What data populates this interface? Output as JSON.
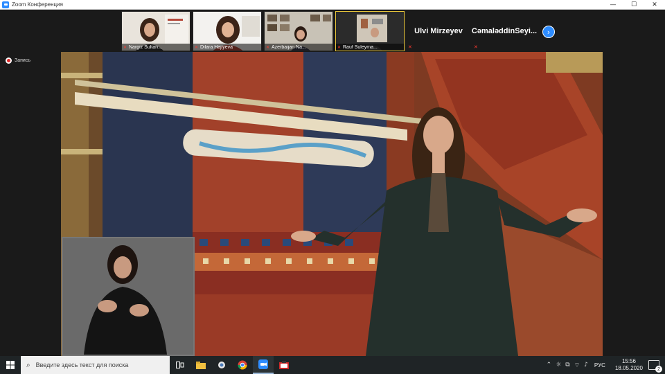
{
  "window": {
    "title": "Zoom Конференция",
    "controls": {
      "minimize": "—",
      "maximize": "☐",
      "close": "✕"
    }
  },
  "gallery": {
    "tiles": [
      {
        "name": "Nargiz Sultan...",
        "muted": true
      },
      {
        "name": "Dilara Hajiyeva",
        "muted": true
      },
      {
        "name": "Azerbaijan Na...",
        "muted": true
      },
      {
        "name": "Rauf Suleyma...",
        "muted": true,
        "active": true
      }
    ],
    "name_only": [
      {
        "name": "Ulvi Mirzeyev",
        "muted": true
      },
      {
        "name": "CəmaləddinSeyi...",
        "muted": true
      }
    ],
    "next_icon": "chevron-right-icon"
  },
  "recording": {
    "label": "Запись"
  },
  "taskbar": {
    "search_placeholder": "Введите здесь текст для поиска",
    "language": "РУС",
    "time": "15:56",
    "date": "18.05.2020",
    "notification_count": "2"
  },
  "colors": {
    "zoom_blue": "#2d8cff",
    "muted_red": "#ff3b30",
    "record_red": "#e02828",
    "active_speaker": "#e8c53a"
  }
}
